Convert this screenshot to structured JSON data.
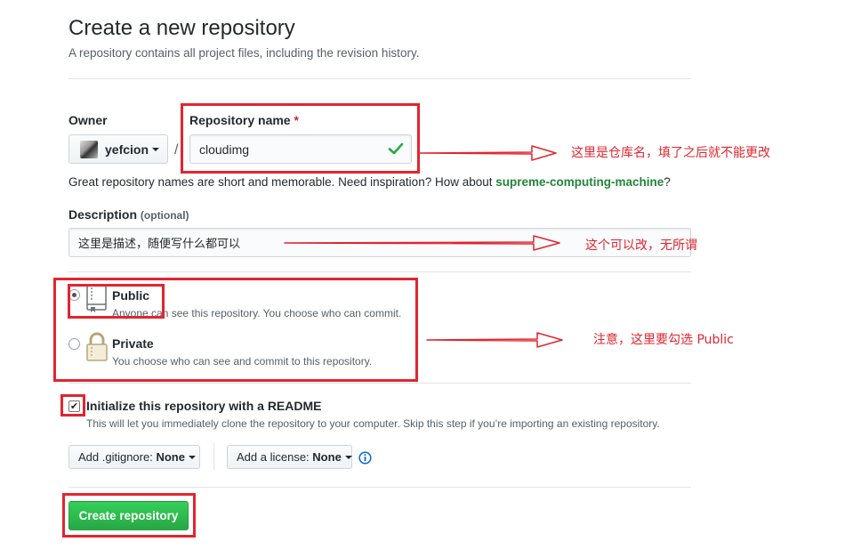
{
  "header": {
    "title": "Create a new repository",
    "subtitle": "A repository contains all project files, including the revision history."
  },
  "owner": {
    "label": "Owner",
    "value": "yefcion",
    "separator": "/"
  },
  "repo_name": {
    "label": "Repository name",
    "required_mark": "*",
    "value": "cloudimg"
  },
  "name_hint": {
    "text": "Great repository names are short and memorable. Need inspiration? How about ",
    "suggestion": "supreme-computing-machine",
    "suffix": "?"
  },
  "description": {
    "label": "Description",
    "optional": "(optional)",
    "value": "这里是描述，随便写什么都可以"
  },
  "visibility": {
    "public_label": "Public",
    "public_desc": "Anyone can see this repository. You choose who can commit.",
    "private_label": "Private",
    "private_desc": "You choose who can see and commit to this repository.",
    "selected": "public"
  },
  "readme": {
    "label": "Initialize this repository with a README",
    "desc": "This will let you immediately clone the repository to your computer. Skip this step if you’re importing an existing repository.",
    "checked": true
  },
  "gitignore": {
    "label": "Add .gitignore:",
    "value": "None"
  },
  "license": {
    "label": "Add a license:",
    "value": "None"
  },
  "info_icon": "info-icon",
  "submit": {
    "label": "Create repository"
  },
  "annotations": {
    "repo_name_note": "这里是仓库名，填了之后就不能更改",
    "description_note": "这个可以改，无所谓",
    "visibility_note": "注意，这里要勾选 Public"
  },
  "colors": {
    "annotation_red": "#e0262f",
    "primary_green": "#2ea44f",
    "suggestion_green": "#22863a",
    "check_green": "#28a745"
  }
}
